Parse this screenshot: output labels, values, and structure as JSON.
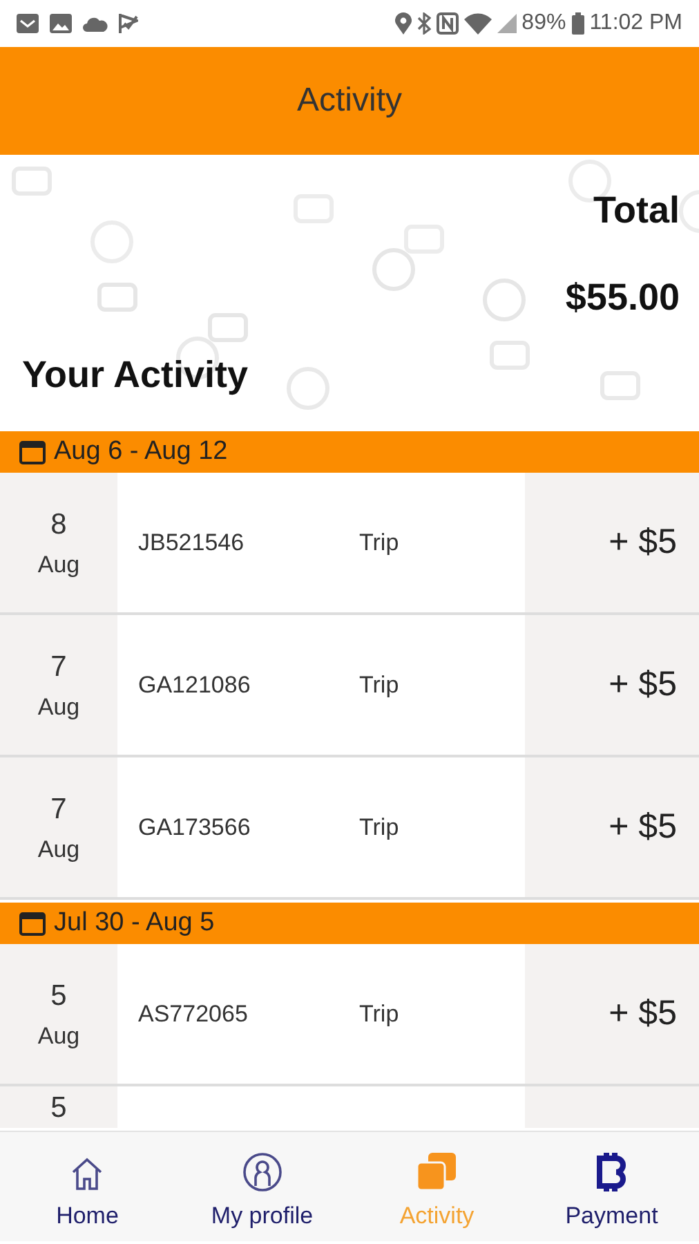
{
  "status_bar": {
    "battery": "89%",
    "time": "11:02 PM"
  },
  "header": {
    "title": "Activity"
  },
  "summary": {
    "total_label": "Total",
    "total_value": "$55.00",
    "heading": "Your Activity"
  },
  "weeks": [
    {
      "range": "Aug 6 - Aug 12",
      "rows": [
        {
          "day": "8",
          "month": "Aug",
          "code": "JB521546",
          "type": "Trip",
          "amount": "+ $5"
        },
        {
          "day": "7",
          "month": "Aug",
          "code": "GA121086",
          "type": "Trip",
          "amount": "+ $5"
        },
        {
          "day": "7",
          "month": "Aug",
          "code": "GA173566",
          "type": "Trip",
          "amount": "+ $5"
        }
      ]
    },
    {
      "range": "Jul 30 - Aug 5",
      "rows": [
        {
          "day": "5",
          "month": "Aug",
          "code": "AS772065",
          "type": "Trip",
          "amount": "+ $5"
        },
        {
          "day": "5"
        }
      ]
    }
  ],
  "tab_bar": [
    {
      "kind": "home",
      "label": "Home",
      "selected": false
    },
    {
      "kind": "profile",
      "label": "My profile",
      "selected": false
    },
    {
      "kind": "activity",
      "label": "Activity",
      "selected": true
    },
    {
      "kind": "payment",
      "label": "Payment",
      "selected": false
    }
  ]
}
